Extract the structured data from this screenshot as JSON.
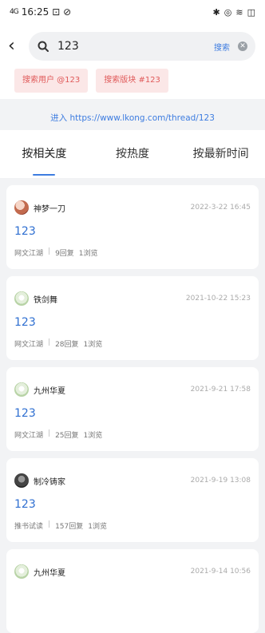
{
  "status": {
    "left_signal": "4G",
    "time": "16:25",
    "battery": "◫"
  },
  "search": {
    "query": "123",
    "search_button": "搜索",
    "clear_label": "✕"
  },
  "chips": [
    "搜索用户 @123",
    "搜索版块 #123"
  ],
  "goto": "进入 https://www.lkong.com/thread/123",
  "tabs": [
    {
      "label": "按相关度",
      "active": true
    },
    {
      "label": "按热度",
      "active": false
    },
    {
      "label": "按最新时间",
      "active": false
    }
  ],
  "results": [
    {
      "user": "神梦一刀",
      "date": "2022-3-22 16:45",
      "title": "123",
      "forum": "网文江湖",
      "replies": "9回复",
      "views": "1浏览",
      "avatar": "red"
    },
    {
      "user": "铁剑舞",
      "date": "2021-10-22 15:23",
      "title": "123",
      "forum": "网文江湖",
      "replies": "28回复",
      "views": "1浏览",
      "avatar": "green"
    },
    {
      "user": "九州华夏",
      "date": "2021-9-21 17:58",
      "title": "123",
      "forum": "网文江湖",
      "replies": "25回复",
      "views": "1浏览",
      "avatar": "green"
    },
    {
      "user": "制冷铸家",
      "date": "2021-9-19 13:08",
      "title": "123",
      "forum": "推书试读",
      "replies": "157回复",
      "views": "1浏览",
      "avatar": "dark"
    },
    {
      "user": "九州华夏",
      "date": "2021-9-14 10:56",
      "title": "",
      "forum": "",
      "replies": "",
      "views": "",
      "avatar": "green"
    }
  ]
}
